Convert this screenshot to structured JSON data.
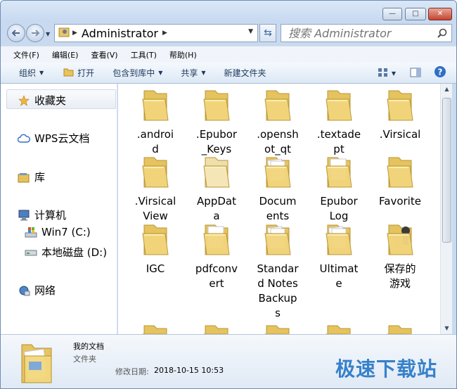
{
  "window": {
    "caption_buttons": {
      "minimize": "—",
      "maximize": "□",
      "close": "✕"
    }
  },
  "address": {
    "path": "Administrator"
  },
  "search": {
    "placeholder": "搜索 Administrator"
  },
  "menu": {
    "items": [
      "文件(F)",
      "编辑(E)",
      "查看(V)",
      "工具(T)",
      "帮助(H)"
    ]
  },
  "toolbar": {
    "organize": "组织",
    "open": "打开",
    "include_in_library": "包含到库中",
    "share": "共享",
    "new_folder": "新建文件夹"
  },
  "nav": {
    "favorites": "收藏夹",
    "wps": "WPS云文档",
    "library": "库",
    "computer": "计算机",
    "drive_c": "Win7 (C:)",
    "drive_d": "本地磁盘 (D:)",
    "network": "网络"
  },
  "files": [
    {
      "lines": [
        ".androi",
        "d"
      ],
      "variant": "plain"
    },
    {
      "lines": [
        ".Epubor",
        "_Keys"
      ],
      "variant": "plain"
    },
    {
      "lines": [
        ".opensh",
        "ot_qt"
      ],
      "variant": "plain"
    },
    {
      "lines": [
        ".textade",
        "pt"
      ],
      "variant": "plain"
    },
    {
      "lines": [
        ".Virsical"
      ],
      "variant": "plain"
    },
    {
      "lines": [
        ".Virsical",
        "View"
      ],
      "variant": "plain"
    },
    {
      "lines": [
        "AppDat",
        "a"
      ],
      "variant": "faded"
    },
    {
      "lines": [
        "Docum",
        "ents"
      ],
      "variant": "docs"
    },
    {
      "lines": [
        "Epubor",
        "Log"
      ],
      "variant": "paper"
    },
    {
      "lines": [
        "Favorite"
      ],
      "variant": "plain"
    },
    {
      "lines": [
        "IGC"
      ],
      "variant": "plain"
    },
    {
      "lines": [
        "pdfconv",
        "ert"
      ],
      "variant": "paper"
    },
    {
      "lines": [
        "Standar",
        "d Notes",
        "Backup",
        "s"
      ],
      "variant": "docs"
    },
    {
      "lines": [
        "Ultimat",
        "e"
      ],
      "variant": "docs"
    },
    {
      "lines": [
        "保存的",
        "游戏"
      ],
      "variant": "chess"
    }
  ],
  "details": {
    "name": "我的文档",
    "type": "文件夹",
    "date_label": "修改日期:",
    "date": "2018-10-15 10:53"
  },
  "watermark": "极速下载站",
  "colors": {
    "accent": "#1f72c4",
    "folder": "#f0d27a",
    "titlebar": "#c9daf0"
  }
}
